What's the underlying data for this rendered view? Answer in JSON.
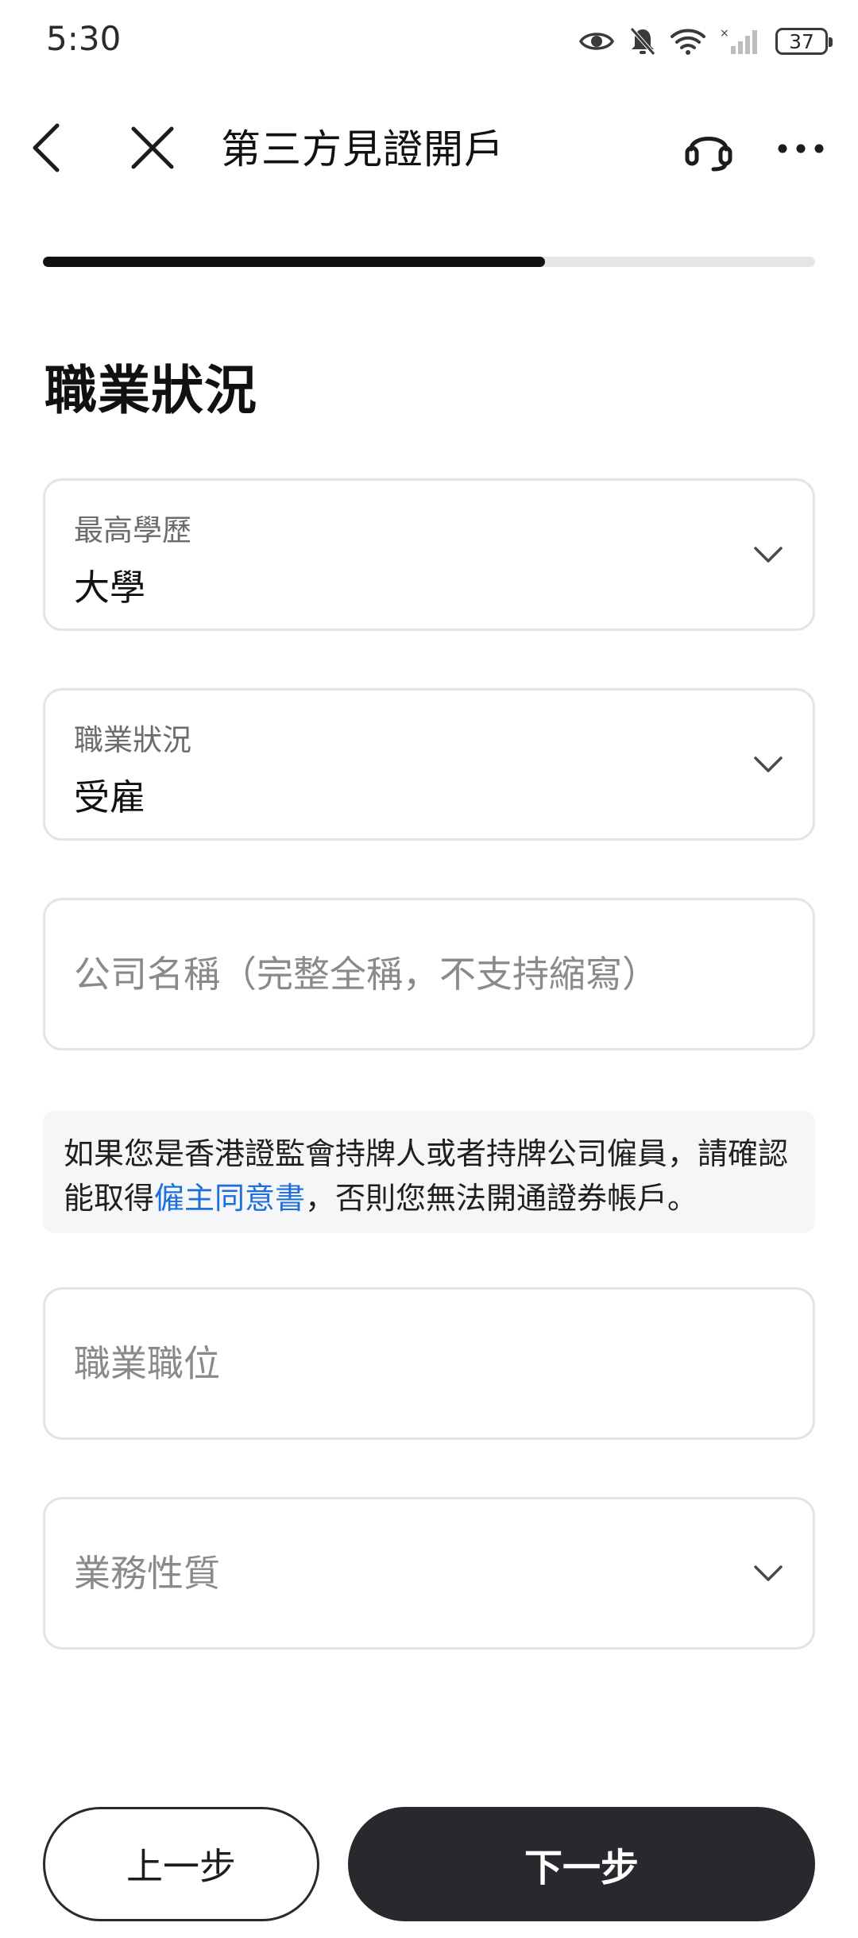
{
  "status_bar": {
    "time": "5:30",
    "battery": "37",
    "icons": [
      "eye-icon",
      "bell-muted-icon",
      "wifi-icon",
      "signal-icon",
      "battery-icon"
    ]
  },
  "nav": {
    "title": "第三方見證開戶",
    "icons": [
      "back-chevron-icon",
      "close-icon",
      "headset-icon",
      "more-icon"
    ]
  },
  "progress": {
    "fraction": 0.65
  },
  "section": {
    "title": "職業狀況"
  },
  "fields": {
    "education": {
      "label": "最高學歷",
      "value": "大學"
    },
    "employment": {
      "label": "職業狀況",
      "value": "受雇"
    },
    "company": {
      "placeholder": "公司名稱（完整全稱，不支持縮寫）"
    },
    "position": {
      "placeholder": "職業職位"
    },
    "business": {
      "placeholder": "業務性質"
    }
  },
  "notice": {
    "text_before": "如果您是香港證監會持牌人或者持牌公司僱員，請確認能取得",
    "link": "僱主同意書",
    "text_after": "，否則您無法開通證券帳戶。"
  },
  "buttons": {
    "prev": "上一步",
    "next": "下一步"
  },
  "colors": {
    "accent_link": "#1e6fd9",
    "primary_button": "#28292d",
    "progress_fill": "#111111"
  }
}
